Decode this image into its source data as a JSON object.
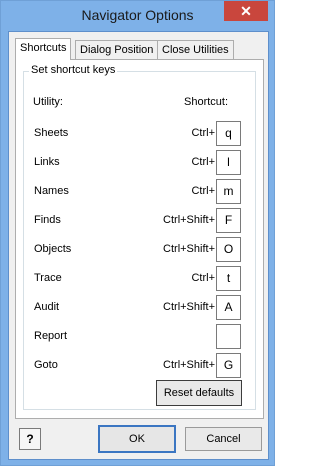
{
  "window": {
    "title": "Navigator Options",
    "close_glyph": "✕"
  },
  "tabs": [
    {
      "label": "Shortcuts",
      "active": true
    },
    {
      "label": "Dialog Position",
      "active": false
    },
    {
      "label": "Close Utilities",
      "active": false
    }
  ],
  "shortcuts": {
    "group_label": "Set shortcut keys",
    "col_utility": "Utility:",
    "col_shortcut": "Shortcut:",
    "rows": [
      {
        "utility": "Sheets",
        "modifier": "Ctrl+",
        "key": "q"
      },
      {
        "utility": "Links",
        "modifier": "Ctrl+",
        "key": "l"
      },
      {
        "utility": "Names",
        "modifier": "Ctrl+",
        "key": "m"
      },
      {
        "utility": "Finds",
        "modifier": "Ctrl+Shift+",
        "key": "F"
      },
      {
        "utility": "Objects",
        "modifier": "Ctrl+Shift+",
        "key": "O"
      },
      {
        "utility": "Trace",
        "modifier": "Ctrl+",
        "key": "t"
      },
      {
        "utility": "Audit",
        "modifier": "Ctrl+Shift+",
        "key": "A"
      },
      {
        "utility": "Report",
        "modifier": "",
        "key": ""
      },
      {
        "utility": "Goto",
        "modifier": "Ctrl+Shift+",
        "key": "G"
      }
    ],
    "reset_label": "Reset defaults"
  },
  "footer": {
    "help_icon": "?",
    "ok_label": "OK",
    "cancel_label": "Cancel"
  },
  "colors": {
    "titlebar": "#7eb1e8",
    "close": "#c9463d",
    "client": "#f0f0f0"
  }
}
